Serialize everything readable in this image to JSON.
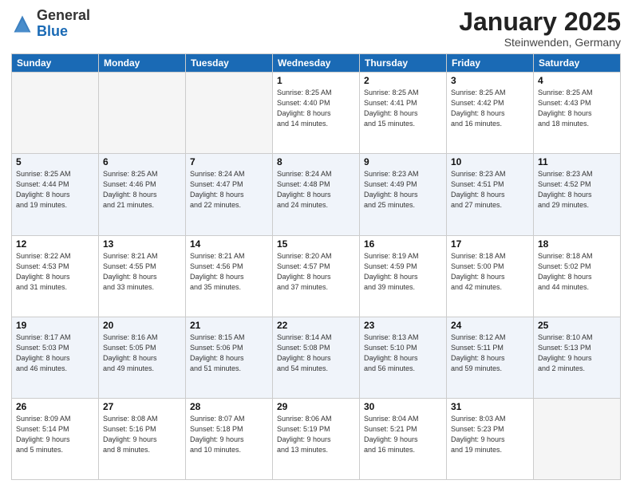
{
  "logo": {
    "general": "General",
    "blue": "Blue"
  },
  "header": {
    "month": "January 2025",
    "location": "Steinwenden, Germany"
  },
  "weekdays": [
    "Sunday",
    "Monday",
    "Tuesday",
    "Wednesday",
    "Thursday",
    "Friday",
    "Saturday"
  ],
  "weeks": [
    [
      {
        "day": "",
        "info": ""
      },
      {
        "day": "",
        "info": ""
      },
      {
        "day": "",
        "info": ""
      },
      {
        "day": "1",
        "info": "Sunrise: 8:25 AM\nSunset: 4:40 PM\nDaylight: 8 hours\nand 14 minutes."
      },
      {
        "day": "2",
        "info": "Sunrise: 8:25 AM\nSunset: 4:41 PM\nDaylight: 8 hours\nand 15 minutes."
      },
      {
        "day": "3",
        "info": "Sunrise: 8:25 AM\nSunset: 4:42 PM\nDaylight: 8 hours\nand 16 minutes."
      },
      {
        "day": "4",
        "info": "Sunrise: 8:25 AM\nSunset: 4:43 PM\nDaylight: 8 hours\nand 18 minutes."
      }
    ],
    [
      {
        "day": "5",
        "info": "Sunrise: 8:25 AM\nSunset: 4:44 PM\nDaylight: 8 hours\nand 19 minutes."
      },
      {
        "day": "6",
        "info": "Sunrise: 8:25 AM\nSunset: 4:46 PM\nDaylight: 8 hours\nand 21 minutes."
      },
      {
        "day": "7",
        "info": "Sunrise: 8:24 AM\nSunset: 4:47 PM\nDaylight: 8 hours\nand 22 minutes."
      },
      {
        "day": "8",
        "info": "Sunrise: 8:24 AM\nSunset: 4:48 PM\nDaylight: 8 hours\nand 24 minutes."
      },
      {
        "day": "9",
        "info": "Sunrise: 8:23 AM\nSunset: 4:49 PM\nDaylight: 8 hours\nand 25 minutes."
      },
      {
        "day": "10",
        "info": "Sunrise: 8:23 AM\nSunset: 4:51 PM\nDaylight: 8 hours\nand 27 minutes."
      },
      {
        "day": "11",
        "info": "Sunrise: 8:23 AM\nSunset: 4:52 PM\nDaylight: 8 hours\nand 29 minutes."
      }
    ],
    [
      {
        "day": "12",
        "info": "Sunrise: 8:22 AM\nSunset: 4:53 PM\nDaylight: 8 hours\nand 31 minutes."
      },
      {
        "day": "13",
        "info": "Sunrise: 8:21 AM\nSunset: 4:55 PM\nDaylight: 8 hours\nand 33 minutes."
      },
      {
        "day": "14",
        "info": "Sunrise: 8:21 AM\nSunset: 4:56 PM\nDaylight: 8 hours\nand 35 minutes."
      },
      {
        "day": "15",
        "info": "Sunrise: 8:20 AM\nSunset: 4:57 PM\nDaylight: 8 hours\nand 37 minutes."
      },
      {
        "day": "16",
        "info": "Sunrise: 8:19 AM\nSunset: 4:59 PM\nDaylight: 8 hours\nand 39 minutes."
      },
      {
        "day": "17",
        "info": "Sunrise: 8:18 AM\nSunset: 5:00 PM\nDaylight: 8 hours\nand 42 minutes."
      },
      {
        "day": "18",
        "info": "Sunrise: 8:18 AM\nSunset: 5:02 PM\nDaylight: 8 hours\nand 44 minutes."
      }
    ],
    [
      {
        "day": "19",
        "info": "Sunrise: 8:17 AM\nSunset: 5:03 PM\nDaylight: 8 hours\nand 46 minutes."
      },
      {
        "day": "20",
        "info": "Sunrise: 8:16 AM\nSunset: 5:05 PM\nDaylight: 8 hours\nand 49 minutes."
      },
      {
        "day": "21",
        "info": "Sunrise: 8:15 AM\nSunset: 5:06 PM\nDaylight: 8 hours\nand 51 minutes."
      },
      {
        "day": "22",
        "info": "Sunrise: 8:14 AM\nSunset: 5:08 PM\nDaylight: 8 hours\nand 54 minutes."
      },
      {
        "day": "23",
        "info": "Sunrise: 8:13 AM\nSunset: 5:10 PM\nDaylight: 8 hours\nand 56 minutes."
      },
      {
        "day": "24",
        "info": "Sunrise: 8:12 AM\nSunset: 5:11 PM\nDaylight: 8 hours\nand 59 minutes."
      },
      {
        "day": "25",
        "info": "Sunrise: 8:10 AM\nSunset: 5:13 PM\nDaylight: 9 hours\nand 2 minutes."
      }
    ],
    [
      {
        "day": "26",
        "info": "Sunrise: 8:09 AM\nSunset: 5:14 PM\nDaylight: 9 hours\nand 5 minutes."
      },
      {
        "day": "27",
        "info": "Sunrise: 8:08 AM\nSunset: 5:16 PM\nDaylight: 9 hours\nand 8 minutes."
      },
      {
        "day": "28",
        "info": "Sunrise: 8:07 AM\nSunset: 5:18 PM\nDaylight: 9 hours\nand 10 minutes."
      },
      {
        "day": "29",
        "info": "Sunrise: 8:06 AM\nSunset: 5:19 PM\nDaylight: 9 hours\nand 13 minutes."
      },
      {
        "day": "30",
        "info": "Sunrise: 8:04 AM\nSunset: 5:21 PM\nDaylight: 9 hours\nand 16 minutes."
      },
      {
        "day": "31",
        "info": "Sunrise: 8:03 AM\nSunset: 5:23 PM\nDaylight: 9 hours\nand 19 minutes."
      },
      {
        "day": "",
        "info": ""
      }
    ]
  ]
}
